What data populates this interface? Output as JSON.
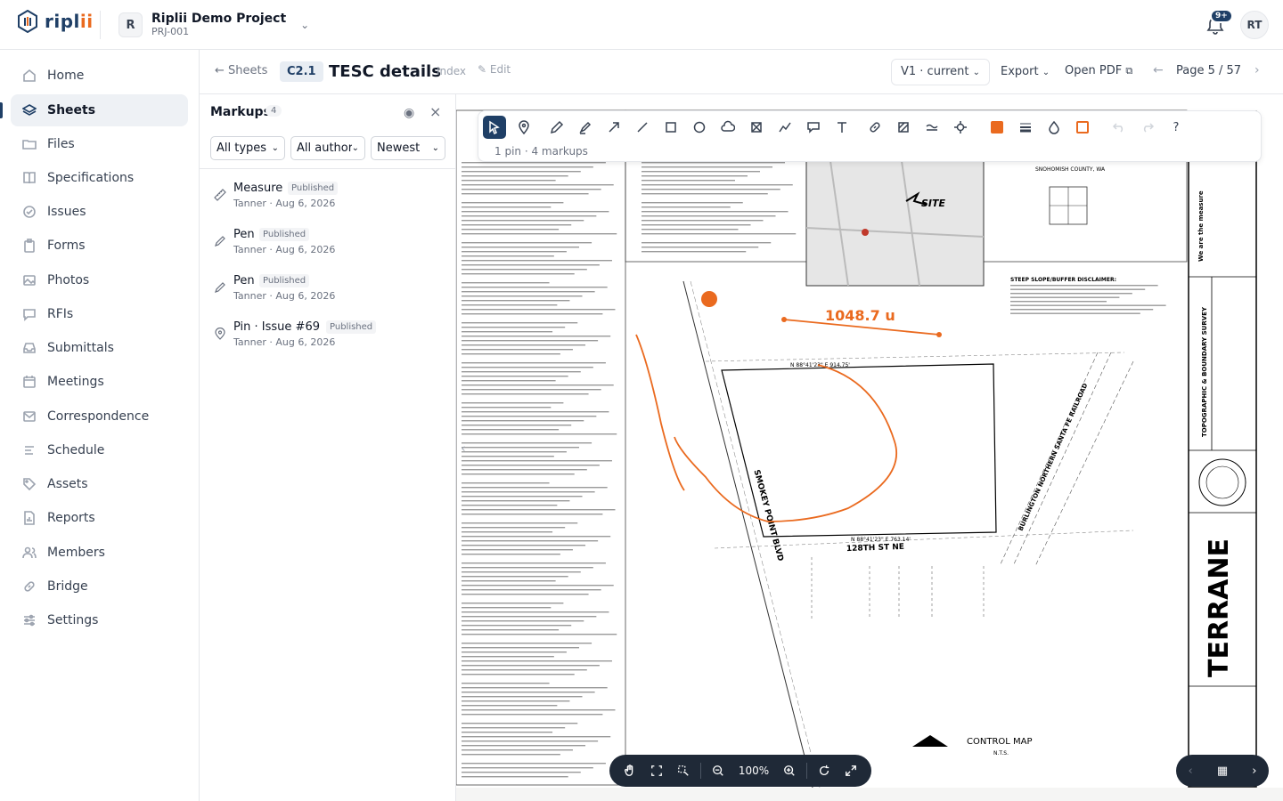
{
  "app": {
    "brand_main": "ripl",
    "brand_accent": "ii"
  },
  "project": {
    "avatar": "R",
    "name": "Riplii Demo Project",
    "code": "PRJ-001"
  },
  "notifications": {
    "badge": "9+"
  },
  "user": {
    "initials": "RT"
  },
  "sidebar": {
    "items": [
      {
        "label": "Home",
        "icon": "home-icon"
      },
      {
        "label": "Sheets",
        "icon": "layers-icon"
      },
      {
        "label": "Files",
        "icon": "folder-icon"
      },
      {
        "label": "Specifications",
        "icon": "book-icon"
      },
      {
        "label": "Issues",
        "icon": "check-circle-icon"
      },
      {
        "label": "Forms",
        "icon": "clipboard-icon"
      },
      {
        "label": "Photos",
        "icon": "image-icon"
      },
      {
        "label": "RFIs",
        "icon": "message-icon"
      },
      {
        "label": "Submittals",
        "icon": "inbox-icon"
      },
      {
        "label": "Meetings",
        "icon": "calendar-icon"
      },
      {
        "label": "Correspondence",
        "icon": "mail-icon"
      },
      {
        "label": "Schedule",
        "icon": "list-icon"
      },
      {
        "label": "Assets",
        "icon": "tag-icon"
      },
      {
        "label": "Reports",
        "icon": "report-icon"
      },
      {
        "label": "Members",
        "icon": "users-icon"
      },
      {
        "label": "Bridge",
        "icon": "link-icon"
      },
      {
        "label": "Settings",
        "icon": "sliders-icon"
      }
    ]
  },
  "sheet": {
    "back_label": "Sheets",
    "number": "C2.1",
    "title": "TESC details",
    "index_label": "Index",
    "edit_label": "Edit",
    "version": "V1 · current",
    "export_label": "Export",
    "open_pdf_label": "Open PDF",
    "page_label": "Page 5 / 57"
  },
  "markups": {
    "title": "Markups",
    "count": "4",
    "filters": {
      "type": "All types",
      "author": "All authors",
      "sort": "Newest"
    },
    "items": [
      {
        "type": "Measure",
        "status": "Published",
        "meta": "Tanner · Aug 6, 2026",
        "icon": "ruler-icon"
      },
      {
        "type": "Pen",
        "status": "Published",
        "meta": "Tanner · Aug 6, 2026",
        "icon": "pen-icon"
      },
      {
        "type": "Pen",
        "status": "Published",
        "meta": "Tanner · Aug 6, 2026",
        "icon": "pen-icon"
      },
      {
        "type": "Pin · Issue #69",
        "status": "Published",
        "meta": "Tanner · Aug 6, 2026",
        "icon": "pin-icon"
      }
    ]
  },
  "toolbar": {
    "summary": "1 pin · 4 markups",
    "help": "?"
  },
  "canvas": {
    "measure_label": "1048.7 u",
    "zoom_level": "100%",
    "drawing": {
      "site_label": "SITE",
      "road1": "SMOKEY POINT BLVD",
      "road2": "128TH ST NE",
      "railroad": "BURLINGTON NORTHERN SANTA FE RAILROAD",
      "control_map": "CONTROL MAP",
      "nts": "N.T.S.",
      "terrane": "TERRANE",
      "tagline": "We are the measure",
      "survey": "TOPOGRAPHIC & BOUNDARY SURVEY",
      "steep_title": "STEEP SLOPE/BUFFER DISCLAIMER:",
      "county": "SNOHOMISH COUNTY, WA",
      "bearing_top": "N 88°41'23\" E  914.75'",
      "bearing_bottom": "N 88°41'23\" E  763.14'"
    }
  },
  "colors": {
    "accent": "#1f3f66",
    "markup": "#ea6a1f"
  }
}
